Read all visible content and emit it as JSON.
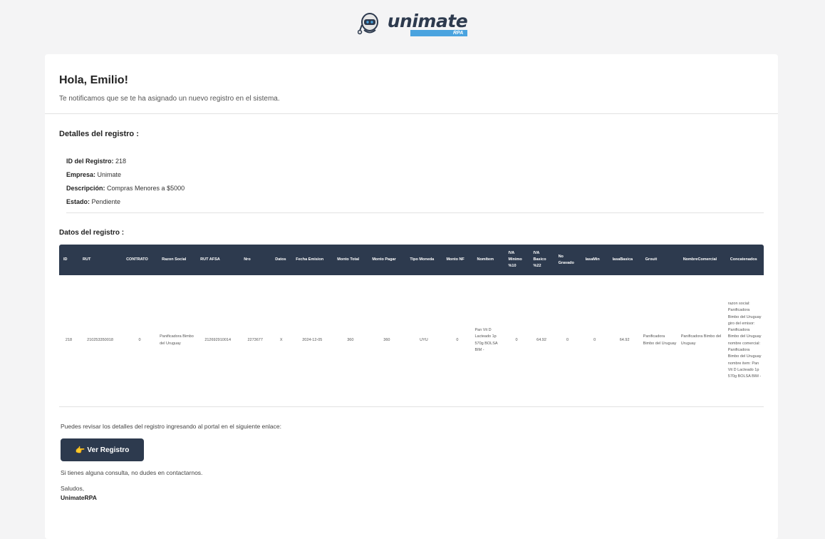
{
  "brand": {
    "name": "unimate",
    "sub": "RPA"
  },
  "greeting": "Hola, Emilio!",
  "intro": "Te notificamos que se te ha asignado un nuevo registro en el sistema.",
  "details": {
    "title": "Detalles del registro :",
    "id_label": "ID del Registro:",
    "id_value": "218",
    "empresa_label": "Empresa:",
    "empresa_value": "Unimate",
    "descripcion_label": "Descripción:",
    "descripcion_value": "Compras Menores a $5000",
    "estado_label": "Estado:",
    "estado_value": "Pendiente"
  },
  "datos_title": "Datos del registro :",
  "table": {
    "headers": [
      "ID",
      "RUT",
      "CONTRATO",
      "Razon Social",
      "RUT AFSA",
      "Nro",
      "Datos",
      "Fecha Emision",
      "Monto Total",
      "Monto Pagar",
      "Tipo Moneda",
      "Monto NF",
      "NomItem",
      "IVA Minimo %10",
      "IVA Basico %22",
      "No Gravado",
      "IasaMin",
      "IasaBasica",
      "Grouit",
      "NombreComercial",
      "Concatenados"
    ],
    "row": [
      "218",
      "210253350018",
      "0",
      "Panificadora Bimbo del Uruguay",
      "212692910014",
      "2273677",
      "X",
      "2024-12-05",
      "360",
      "360",
      "UYU",
      "0",
      "Pan Vit D Lacteado 1p 570g BOLSA BIM -",
      "0",
      "64.92",
      "0",
      "0",
      "64.92",
      "Panificadora Bimbo del Uruguay",
      "Panificadora Bimbo del Uruguay",
      "razon social: Panificadora Bimbo del Uruguay giro del emisor: Panificadora Bimbo del Uruguay nombre comercial: Panificadora Bimbo del Uruguay nombre item: Pan Vit D Lacteado 1p 570g BOLSA BIM -"
    ]
  },
  "review_text": "Puedes revisar los detalles del registro ingresando al portal en el siguiente enlace:",
  "button": {
    "icon": "pointing-hand-icon",
    "label": "Ver Registro"
  },
  "contact": "Si tienes alguna consulta, no dudes en contactarnos.",
  "saludos": "Saludos,",
  "signature": "UnimateRPA",
  "colors": {
    "primary": "#2d3a4e",
    "accent": "#4aa3df",
    "background": "#f4f4f5"
  }
}
